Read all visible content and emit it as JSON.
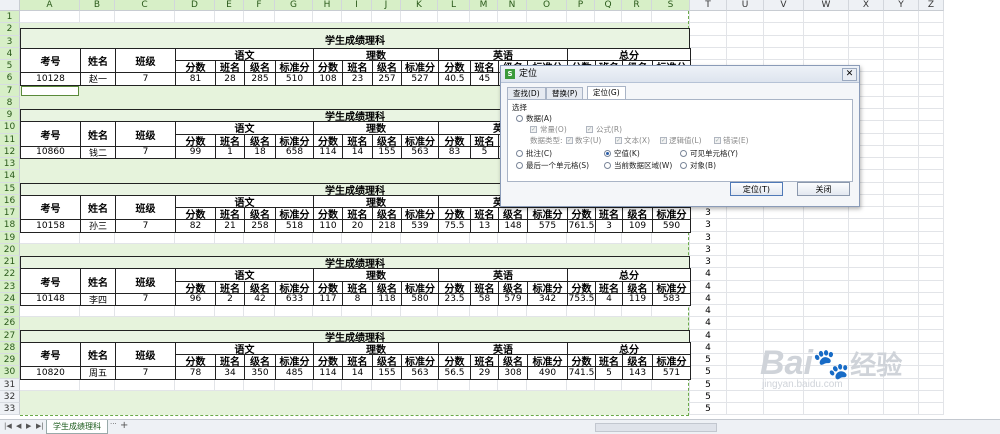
{
  "columns": [
    "A",
    "B",
    "C",
    "D",
    "E",
    "F",
    "G",
    "H",
    "I",
    "J",
    "K",
    "L",
    "M",
    "N",
    "O",
    "P",
    "Q",
    "R",
    "S",
    "T",
    "U",
    "V",
    "W",
    "X",
    "Y",
    "Z"
  ],
  "rows": [
    "1",
    "2",
    "3",
    "4",
    "5",
    "6",
    "7",
    "8",
    "9",
    "10",
    "11",
    "12",
    "13",
    "14",
    "15",
    "16",
    "17",
    "18",
    "19",
    "20",
    "21",
    "22",
    "23",
    "24",
    "25",
    "26",
    "27",
    "28",
    "29",
    "30",
    "31",
    "32",
    "33"
  ],
  "table_title": "学生成绩理科",
  "headers": {
    "id": "考号",
    "name": "姓名",
    "class": "班级",
    "subjects": [
      "语文",
      "理数",
      "英语",
      "总分"
    ],
    "subcols": [
      "分数",
      "班名",
      "级名",
      "标准分"
    ]
  },
  "blocks": [
    {
      "id": "10128",
      "name": "赵一",
      "class": "7",
      "scores": [
        "81",
        "28",
        "285",
        "510",
        "108",
        "23",
        "257",
        "527",
        "40.5",
        "45",
        "",
        "",
        "",
        "",
        "",
        ""
      ]
    },
    {
      "id": "10860",
      "name": "钱二",
      "class": "7",
      "scores": [
        "99",
        "1",
        "18",
        "658",
        "114",
        "14",
        "155",
        "563",
        "83",
        "5",
        "",
        "",
        "",
        "",
        "",
        ""
      ]
    },
    {
      "id": "10158",
      "name": "孙三",
      "class": "7",
      "scores": [
        "82",
        "21",
        "258",
        "518",
        "110",
        "20",
        "218",
        "539",
        "75.5",
        "13",
        "148",
        "575",
        "761.5",
        "3",
        "109",
        "590"
      ]
    },
    {
      "id": "10148",
      "name": "李四",
      "class": "7",
      "scores": [
        "96",
        "2",
        "42",
        "633",
        "117",
        "8",
        "118",
        "580",
        "23.5",
        "58",
        "579",
        "342",
        "753.5",
        "4",
        "119",
        "583"
      ]
    },
    {
      "id": "10820",
      "name": "周五",
      "class": "7",
      "scores": [
        "78",
        "34",
        "350",
        "485",
        "114",
        "14",
        "155",
        "563",
        "56.5",
        "29",
        "308",
        "490",
        "741.5",
        "5",
        "143",
        "571"
      ]
    }
  ],
  "side_values": [
    "2",
    "2",
    "2",
    "3",
    "3",
    "3",
    "3",
    "3",
    "3",
    "3",
    "4",
    "4",
    "4",
    "4",
    "4",
    "4",
    "4",
    "5",
    "5",
    "5",
    "5",
    "5"
  ],
  "dialog": {
    "title": "定位",
    "tabs": [
      "查找(D)",
      "替换(P)",
      "定位(G)"
    ],
    "group": "选择",
    "data_radio": "数据(A)",
    "const": "常量(O)",
    "formula": "公式(R)",
    "data_type_label": "数据类型:",
    "number": "数字(U)",
    "text": "文本(X)",
    "logic": "逻辑值(L)",
    "error": "错误(E)",
    "comment": "批注(C)",
    "blank": "空值(K)",
    "visible": "可见单元格(Y)",
    "last_cell": "最后一个单元格(S)",
    "current_region": "当前数据区域(W)",
    "object": "对象(B)",
    "go_btn": "定位(T)",
    "close_btn": "关闭"
  },
  "sheet_tab": "学生成绩理科",
  "watermark": {
    "brand": "Bai",
    "cn": "经验",
    "url": "jingyan.baidu.com"
  }
}
